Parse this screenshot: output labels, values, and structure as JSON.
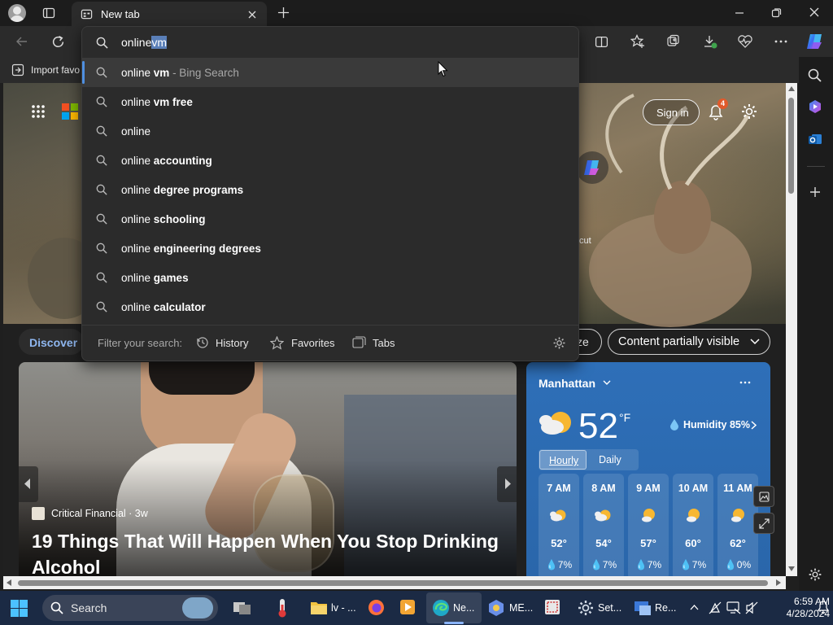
{
  "browser": {
    "tab_title": "New tab",
    "favorites_bar_label": "Import favo",
    "address_text_typed": "online",
    "address_text_selected": "vm"
  },
  "suggestions": [
    {
      "plain": "online ",
      "bold": "vm",
      "sub": " - Bing Search"
    },
    {
      "plain": "online ",
      "bold": "vm free",
      "sub": ""
    },
    {
      "plain": "online",
      "bold": "",
      "sub": ""
    },
    {
      "plain": "online ",
      "bold": "accounting",
      "sub": ""
    },
    {
      "plain": "online ",
      "bold": "degree programs",
      "sub": ""
    },
    {
      "plain": "online ",
      "bold": "schooling",
      "sub": ""
    },
    {
      "plain": "online ",
      "bold": "engineering degrees",
      "sub": ""
    },
    {
      "plain": "online ",
      "bold": "games",
      "sub": ""
    },
    {
      "plain": "online ",
      "bold": "calculator",
      "sub": ""
    }
  ],
  "filter": {
    "label": "Filter your search:",
    "history": "History",
    "favorites": "Favorites",
    "tabs": "Tabs"
  },
  "newtab": {
    "sign_in": "Sign in",
    "notification_count": "4",
    "hero_fragment": "cut",
    "discover": "Discover",
    "personalize_fragment": "ze",
    "content_visibility": "Content partially visible"
  },
  "news": {
    "source": "Critical Financial · 3w",
    "headline": "19 Things That Will Happen When You Stop Drinking Alcohol"
  },
  "weather": {
    "location": "Manhattan",
    "temp": "52",
    "unit": "°F",
    "humidity": "Humidity 85%",
    "tab_hourly": "Hourly",
    "tab_daily": "Daily",
    "hours": [
      {
        "time": "7 AM",
        "temp": "52°",
        "precip": "7%"
      },
      {
        "time": "8 AM",
        "temp": "54°",
        "precip": "7%"
      },
      {
        "time": "9 AM",
        "temp": "57°",
        "precip": "7%"
      },
      {
        "time": "10 AM",
        "temp": "60°",
        "precip": "7%"
      },
      {
        "time": "11 AM",
        "temp": "62°",
        "precip": "0%"
      }
    ]
  },
  "taskbar": {
    "search_placeholder": "Search",
    "items": [
      "lv - ...",
      "Ne...",
      "ME...",
      "Set...",
      "Re..."
    ],
    "time": "6:59 AM",
    "date": "4/28/2024"
  },
  "colors": {
    "accent": "#4f8fe0",
    "selection": "#5a7fb8",
    "weather_bg": "#2e6fb8",
    "notification": "#e05a2b"
  }
}
